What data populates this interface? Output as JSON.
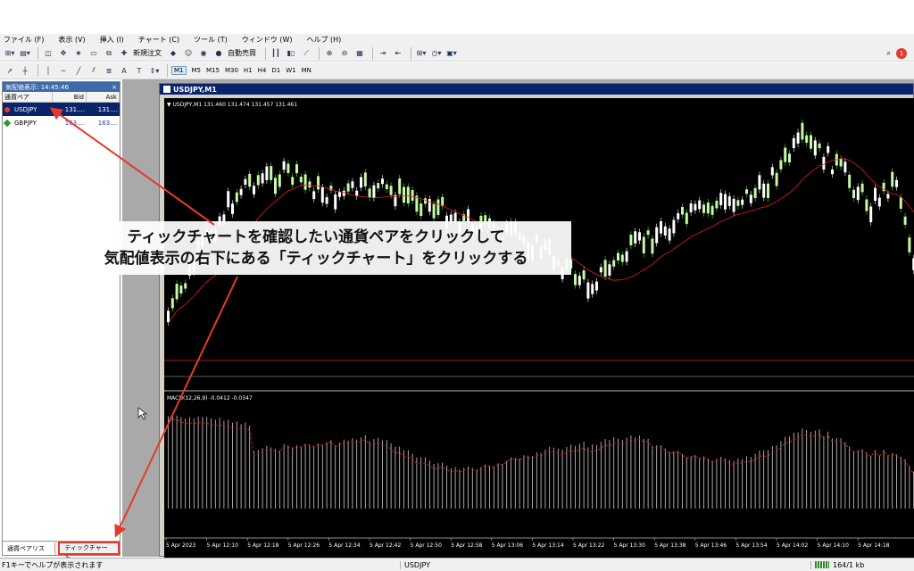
{
  "menu": [
    "ファイル (F)",
    "表示 (V)",
    "挿入 (I)",
    "チャート (C)",
    "ツール (T)",
    "ウィンドウ (W)",
    "ヘルプ (H)"
  ],
  "toolbar1": {
    "new_order": "新規注文",
    "auto_trade": "自動売買",
    "notification_count": "1"
  },
  "toolbar2": {
    "timeframes": [
      "M1",
      "M5",
      "M15",
      "M30",
      "H1",
      "H4",
      "D1",
      "W1",
      "MN"
    ],
    "text_tool": "A",
    "label_tool": "T"
  },
  "market_watch": {
    "title": "気配値表示: 14:45:46",
    "close_glyph": "×",
    "columns": [
      "通貨ペア",
      "Bid",
      "Ask"
    ],
    "rows": [
      {
        "symbol": "USDJPY",
        "bid": "131....",
        "ask": "131...."
      },
      {
        "symbol": "GBPJPY",
        "bid": "163....",
        "ask": "163...."
      }
    ],
    "tabs": [
      "通貨ペアリスト",
      "ティックチャート"
    ]
  },
  "chart": {
    "window_title": "USDJPY,M1",
    "info": "▼ USDJPY,M1  131.460 131.474 131.457 131.461",
    "macd_label": "MACD(12,26,9) -0.0412 -0.0347",
    "time_labels": [
      "5 Apr 2023",
      "5 Apr 12:10",
      "5 Apr 12:18",
      "5 Apr 12:26",
      "5 Apr 12:34",
      "5 Apr 12:42",
      "5 Apr 12:50",
      "5 Apr 12:58",
      "5 Apr 13:06",
      "5 Apr 13:14",
      "5 Apr 13:22",
      "5 Apr 13:30",
      "5 Apr 13:38",
      "5 Apr 13:46",
      "5 Apr 13:54",
      "5 Apr 14:02",
      "5 Apr 14:10",
      "5 Apr 14:18"
    ],
    "colors": {
      "bull": "#c8f7a8",
      "bear": "#ffffff",
      "ma": "#e02020",
      "wick_up": "#38d038"
    }
  },
  "overlay": {
    "line1": "ティックチャートを確認したい通貨ペアをクリックして",
    "line2": "気配値表示の右下にある「ティックチャート」をクリックする"
  },
  "status": {
    "help": "F1キーでヘルプが表示されます",
    "symbol": "USDJPY",
    "traffic": "164/1 kb"
  }
}
